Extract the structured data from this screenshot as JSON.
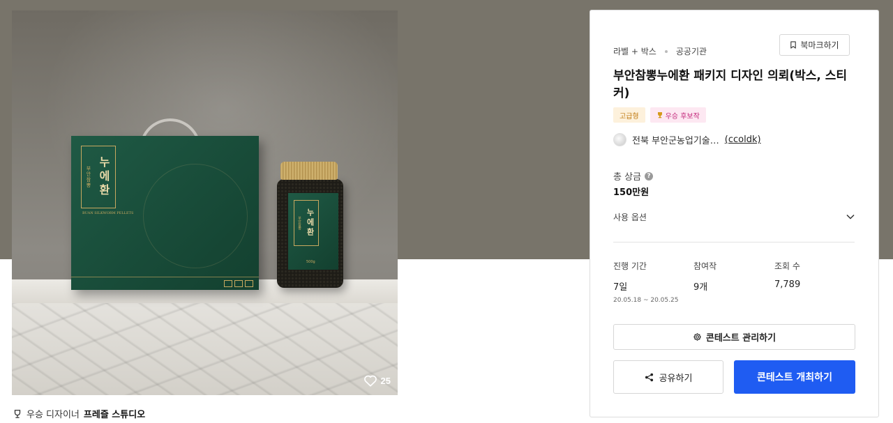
{
  "hero": {
    "box": {
      "label_small": "부안참뽕",
      "label_big": "누에환",
      "seal": "환",
      "eng": "BUAN SILKWORM PELLETS"
    },
    "jar": {
      "label_small": "부안참뽕",
      "label_big": "누에환",
      "weight": "500g"
    },
    "like_count": "25"
  },
  "winner": {
    "prefix": "우승 디자이너",
    "studio": "프레즐 스튜디오"
  },
  "card": {
    "category": "라벨 + 박스",
    "client_type": "공공기관",
    "bookmark_label": "북마크하기",
    "title": "부안참뽕누에환 패키지 디자인 의뢰(박스, 스티커)",
    "tags": {
      "premium": "고급형",
      "candidate": "우승 후보작"
    },
    "org_name": "전북 부안군농업기술…",
    "org_handle": "(ccoldk)",
    "prize_label": "총 상금",
    "prize_value": "150만원",
    "options_label": "사용 옵션",
    "stats": {
      "period_label": "진행 기간",
      "period_value": "7일",
      "period_range": "20.05.18 ~ 20.05.25",
      "entries_label": "참여작",
      "entries_value": "9개",
      "views_label": "조회 수",
      "views_value": "7,789"
    },
    "manage_label": "콘테스트 관리하기",
    "share_label": "공유하기",
    "host_label": "콘테스트 개최하기"
  },
  "colors": {
    "accent": "#1f5cf2",
    "premium_tag_bg": "#fdf1dc",
    "candidate_tag_bg": "#fde8f2",
    "top_background": "#78746a"
  },
  "icons": [
    "heart-icon",
    "trophy-icon",
    "bookmark-icon",
    "trophy-small-icon",
    "help-icon",
    "chevron-down-icon",
    "gear-icon",
    "share-icon"
  ]
}
